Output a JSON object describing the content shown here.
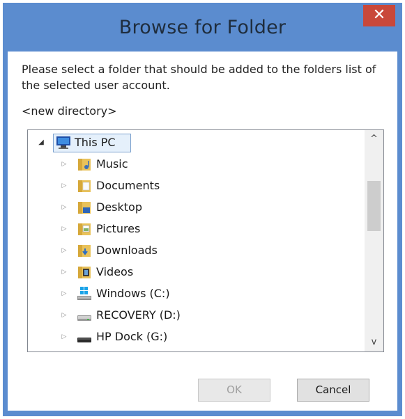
{
  "dialog": {
    "title": "Browse for Folder",
    "close_label": "✕",
    "description": "Please select a folder that should be added to the folders list of the selected user account.",
    "selected_path": "<new directory>"
  },
  "tree": {
    "root": {
      "label": "This PC",
      "expanded": true,
      "selected": true,
      "icon": "computer-icon"
    },
    "items": [
      {
        "label": "Music",
        "icon": "music-folder-icon"
      },
      {
        "label": "Documents",
        "icon": "documents-folder-icon"
      },
      {
        "label": "Desktop",
        "icon": "desktop-folder-icon"
      },
      {
        "label": "Pictures",
        "icon": "pictures-folder-icon"
      },
      {
        "label": "Downloads",
        "icon": "downloads-folder-icon"
      },
      {
        "label": "Videos",
        "icon": "videos-folder-icon"
      },
      {
        "label": "Windows (C:)",
        "icon": "windows-drive-icon"
      },
      {
        "label": "RECOVERY (D:)",
        "icon": "drive-icon"
      },
      {
        "label": "HP Dock (G:)",
        "icon": "removable-drive-icon"
      }
    ]
  },
  "scrollbar": {
    "up": "^",
    "down": "v"
  },
  "buttons": {
    "ok": "OK",
    "cancel": "Cancel",
    "ok_enabled": false
  },
  "colors": {
    "frame": "#5b8ccf",
    "close": "#c9483a",
    "selection": "#e5f0fb"
  }
}
